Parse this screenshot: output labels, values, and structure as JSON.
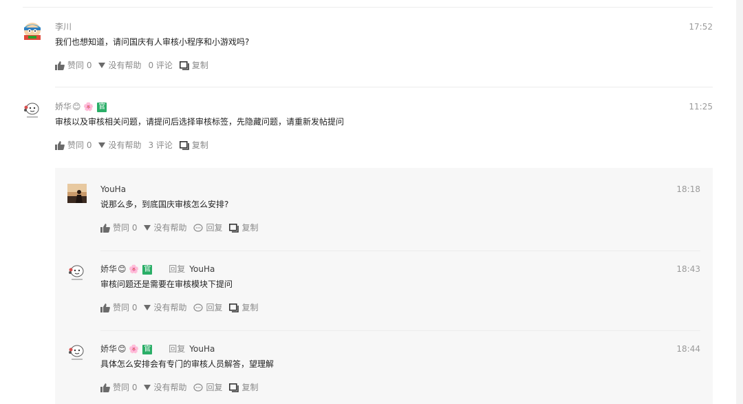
{
  "comments": [
    {
      "name": "李川",
      "time": "17:52",
      "text": "我们也想知道，请问国庆有人审核小程序和小游戏吗?",
      "like_label": "赞同 0",
      "unhelpful_label": "没有帮助",
      "comment_label": "0 评论",
      "copy_label": "复制"
    },
    {
      "name": "娇华",
      "badge_emojis": "😊 🌸",
      "official_badge": "官",
      "time": "11:25",
      "text": "审核以及审核相关问题，请提问后选择审核标签，先隐藏问题，请重新发帖提问",
      "like_label": "赞同 0",
      "unhelpful_label": "没有帮助",
      "comment_label": "3 评论",
      "copy_label": "复制"
    }
  ],
  "replies": [
    {
      "name": "YouHa",
      "time": "18:18",
      "text": "说那么多，到底国庆审核怎么安排?",
      "like_label": "赞同 0",
      "unhelpful_label": "没有帮助",
      "reply_label": "回复",
      "copy_label": "复制"
    },
    {
      "name": "娇华",
      "badge_emojis": "😊 🌸",
      "official_badge": "官",
      "reply_word": "回复",
      "reply_to": "YouHa",
      "time": "18:43",
      "text": "审核问题还是需要在审核模块下提问",
      "like_label": "赞同 0",
      "unhelpful_label": "没有帮助",
      "reply_label": "回复",
      "copy_label": "复制"
    },
    {
      "name": "娇华",
      "badge_emojis": "😊 🌸",
      "official_badge": "官",
      "reply_word": "回复",
      "reply_to": "YouHa",
      "time": "18:44",
      "text": "具体怎么安排会有专门的审核人员解答，望理解",
      "like_label": "赞同 0",
      "unhelpful_label": "没有帮助",
      "reply_label": "回复",
      "copy_label": "复制"
    }
  ],
  "colors": {
    "official": "#2aae67",
    "thread_bg": "#f7f7f7",
    "meta": "#8a8a8a"
  },
  "icons": {
    "like": "thumbs-up-icon",
    "unhelpful": "triangle-down-icon",
    "reply": "speech-bubble-icon",
    "copy": "copy-icon"
  }
}
